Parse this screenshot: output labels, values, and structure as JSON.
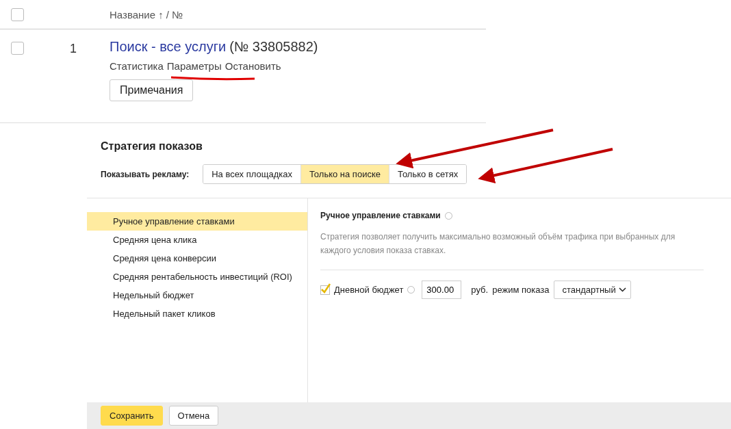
{
  "table": {
    "header": {
      "checked": false,
      "column_title": "Название ↑ / №"
    },
    "rows": [
      {
        "checked": false,
        "number": "1",
        "name": "Поиск - все услуги",
        "id": "(№ 33805882)",
        "actions": [
          "Статистика",
          "Параметры",
          "Остановить"
        ],
        "notes_button": "Примечания"
      }
    ]
  },
  "dialog": {
    "title": "Стратегия показов",
    "show_ads_label": "Показывать рекламу:",
    "placement_tabs": [
      {
        "label": "На всех площадках",
        "selected": false
      },
      {
        "label": "Только на поиске",
        "selected": true
      },
      {
        "label": "Только в сетях",
        "selected": false
      }
    ],
    "strategies": [
      {
        "label": "Ручное управление ставками",
        "selected": true
      },
      {
        "label": "Средняя цена клика",
        "selected": false
      },
      {
        "label": "Средняя цена конверсии",
        "selected": false
      },
      {
        "label": "Средняя рентабельность инвестиций (ROI)",
        "selected": false
      },
      {
        "label": "Недельный бюджет",
        "selected": false
      },
      {
        "label": "Недельный пакет кликов",
        "selected": false
      }
    ],
    "detail": {
      "title": "Ручное управление ставками",
      "description": "Стратегия позволяет получить максимально возможный объём трафика при выбранных для каждого условия показа ставках.",
      "daily_budget": {
        "checked": true,
        "label": "Дневной бюджет",
        "value": "300.00",
        "currency": "руб.",
        "mode_label": "режим показа",
        "mode": "стандартный"
      }
    },
    "buttons": [
      {
        "label": "Сохранить",
        "kind": "primary"
      },
      {
        "label": "Отмена",
        "kind": "secondary"
      }
    ]
  }
}
